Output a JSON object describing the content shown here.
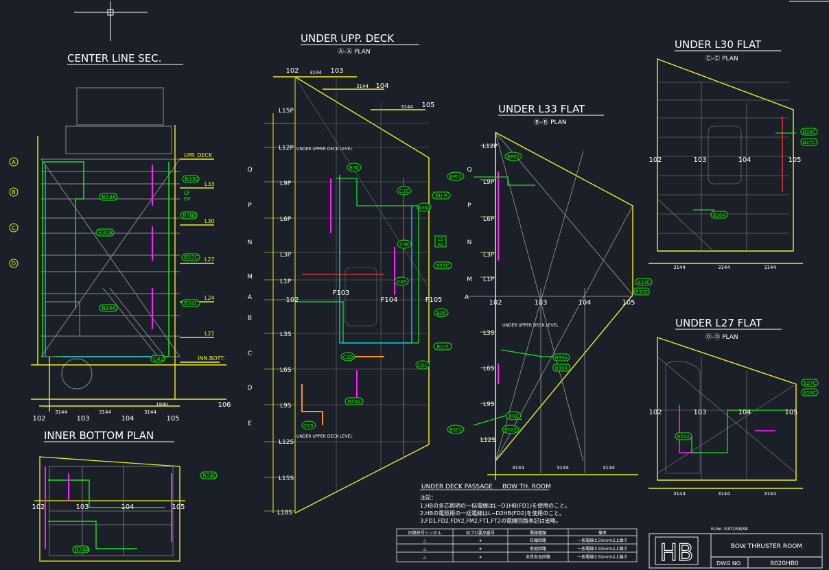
{
  "titles": {
    "center_line": "CENTER LINE SEC.",
    "inner_bottom": "INNER BOTTOM PLAN",
    "under_upp_deck": "UNDER UPP. DECK",
    "under_upp_deck_sub": "Ⓐ-Ⓐ PLAN",
    "under_l33": "UNDER L33 FLAT",
    "under_l33_sub": "Ⓑ-Ⓑ PLAN",
    "under_l30": "UNDER L30 FLAT",
    "under_l30_sub": "Ⓒ-Ⓒ PLAN",
    "under_l27": "UNDER L27 FLAT",
    "under_l27_sub": "Ⓓ-Ⓓ PLAN"
  },
  "colors": {
    "bg": "#1b2028",
    "title": "#ffffff",
    "structure": "#b8b8b8",
    "hull": "#f0f020",
    "cable": "#20e020",
    "tag": "#00c853",
    "magenta": "#ff20ff",
    "red": "#ff3030",
    "orange": "#ff9020",
    "cyan": "#20d0ff"
  },
  "center_line": {
    "levels": [
      "UPP. DECK",
      "L33",
      "L30",
      "L27",
      "L24",
      "L21",
      "INN.BOTT."
    ],
    "section_marks": [
      "A",
      "B",
      "C",
      "D"
    ],
    "frames": [
      "102",
      "103",
      "104",
      "105",
      "106"
    ],
    "dims": [
      "3144",
      "3144",
      "3144",
      "1990"
    ],
    "tags": [
      "B33C",
      "B33A",
      "B30C",
      "B30A",
      "B27C",
      "B24C",
      "B24A",
      "C42",
      "LF",
      "FP"
    ]
  },
  "inner_bottom": {
    "frames": [
      "102",
      "103",
      "104",
      "105"
    ],
    "tags": [
      "B24C",
      "B24A"
    ]
  },
  "upp_deck": {
    "frames_top": [
      "102",
      "103",
      "104",
      "105"
    ],
    "dims_top": [
      "3144",
      "3144",
      "3144"
    ],
    "rows_left": [
      "L15P",
      "L12P",
      "L9P",
      "L6P",
      "L3P",
      "L1P",
      "L3S",
      "L6S",
      "L9S",
      "L12S",
      "L15S",
      "L18S"
    ],
    "rows_letters": [
      "Q",
      "P",
      "N",
      "M",
      "A",
      "B",
      "C",
      "D",
      "E"
    ],
    "mid_frames": [
      "102",
      "F103",
      "F104",
      "F105"
    ],
    "tags": [
      "B30",
      "B33",
      "B33C",
      "B33A",
      "B05",
      "BU-S",
      "BU-P",
      "LS",
      "FA",
      "C3D",
      "C5C",
      "B30",
      "C05",
      "C4P",
      "C5P",
      "C2C",
      "B33A"
    ],
    "labels": [
      "UNDER UPPER DECK LEVEL",
      "UNDER UPPER DECK LEVEL"
    ]
  },
  "l33": {
    "frames": [
      "102",
      "103",
      "104",
      "105"
    ],
    "dims": [
      "3144",
      "3144",
      "3144"
    ],
    "rows_left": [
      "L12P",
      "L9P",
      "L6P",
      "L3P",
      "L1P",
      "L3S",
      "L6S",
      "L9S",
      "L12S"
    ],
    "rows_letters": [
      "Q",
      "P",
      "N",
      "M",
      "A"
    ],
    "tags": [
      "BP02",
      "BP01",
      "B33C",
      "B30C",
      "B33A",
      "B30A",
      "B02",
      "BS01",
      "BS02"
    ],
    "label": "UNDER UPPER DECK LEVEL"
  },
  "l30": {
    "frames": [
      "102",
      "103",
      "104",
      "105"
    ],
    "dims": [
      "3144",
      "3144",
      "3144"
    ],
    "tags": [
      "B30C",
      "B27C",
      "B30A"
    ]
  },
  "l27": {
    "frames": [
      "102",
      "103",
      "104",
      "105"
    ],
    "dims": [
      "3144",
      "3144",
      "3144"
    ],
    "tags": [
      "B27C",
      "B24C",
      "B24A"
    ]
  },
  "passage": {
    "left": "UNDER DECK PASSAGE",
    "right": "BOW TH. ROOM"
  },
  "notes": {
    "heading": "注記：",
    "lines": [
      "1.HBの多芯照明の一括電線はL−D1HB(FD1)を使用のこと。",
      "2.HBの電照用の一括電線はL−D2HB(FD2)を使用のこと。",
      "3.FD1,FD2,FDY2,FM2,FT1,FT2の電線回路表記は省略。"
    ]
  },
  "legend_table": {
    "headers": [
      "回路符号シンボル",
      "記プロ要品番号",
      "電線種類",
      "備考"
    ],
    "rows": [
      [
        "△",
        "∗",
        "防爆回路",
        "一般電線と50mm以上離す"
      ],
      [
        "△",
        "∗",
        "家庭回路",
        "一般電線と50mm以上離す"
      ],
      [
        "△",
        "∗",
        "本質安全回路",
        "一般電線と50mm以上離す"
      ]
    ]
  },
  "title_block": {
    "logo": "HB",
    "ref": "ELNo. S307/S8/S8",
    "title": "BOW THRUSTER ROOM",
    "dwg_label": "DWG NO.",
    "dwg_no": "8020HB0"
  }
}
